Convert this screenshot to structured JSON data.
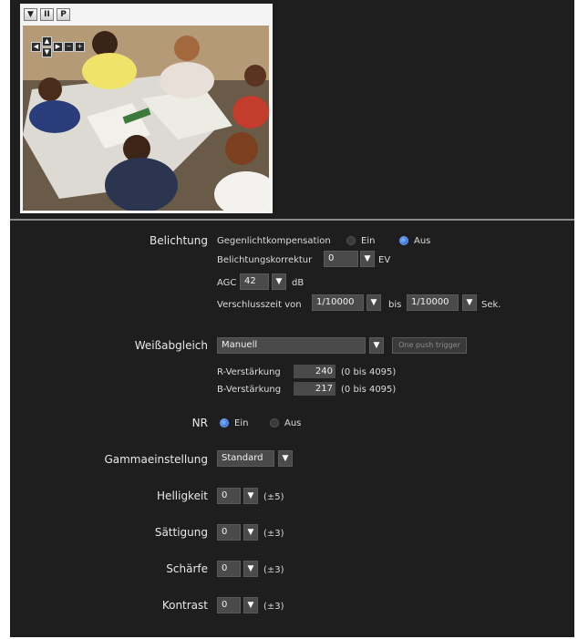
{
  "camera": {
    "toolbar": {
      "menu_icon": "▼",
      "pause_icon": "II",
      "preset_icon": "P"
    }
  },
  "belichtung": {
    "label": "Belichtung",
    "gegenlicht_label": "Gegenlichtkompensation",
    "option_ein": "Ein",
    "option_aus": "Aus",
    "gegenlicht_selected": "Aus",
    "korrektur_label": "Belichtungskorrektur",
    "korrektur_value": "0",
    "korrektur_unit": "EV",
    "agc_label": "AGC",
    "agc_value": "42",
    "agc_unit": "dB",
    "verschluss_label": "Verschlusszeit von",
    "verschluss_from": "1/10000",
    "verschluss_bis": "bis",
    "verschluss_to": "1/10000",
    "verschluss_unit": "Sek."
  },
  "weissabgleich": {
    "label": "Weißabgleich",
    "mode": "Manuell",
    "push_button": "One push trigger",
    "r_label": "R-Verstärkung",
    "r_value": "240",
    "r_range": "(0 bis 4095)",
    "b_label": "B-Verstärkung",
    "b_value": "217",
    "b_range": "(0 bis 4095)"
  },
  "nr": {
    "label": "NR",
    "option_ein": "Ein",
    "option_aus": "Aus",
    "selected": "Ein"
  },
  "gamma": {
    "label": "Gammaeinstellung",
    "value": "Standard"
  },
  "helligkeit": {
    "label": "Helligkeit",
    "value": "0",
    "range": "(±5)"
  },
  "saettigung": {
    "label": "Sättigung",
    "value": "0",
    "range": "(±3)"
  },
  "schaerfe": {
    "label": "Schärfe",
    "value": "0",
    "range": "(±3)"
  },
  "kontrast": {
    "label": "Kontrast",
    "value": "0",
    "range": "(±3)"
  },
  "dropdown_arrow": "▼",
  "colors": {
    "panel": "#1e1e1e",
    "field": "#4a4a4a",
    "radio_on": "#2f6fdc"
  }
}
